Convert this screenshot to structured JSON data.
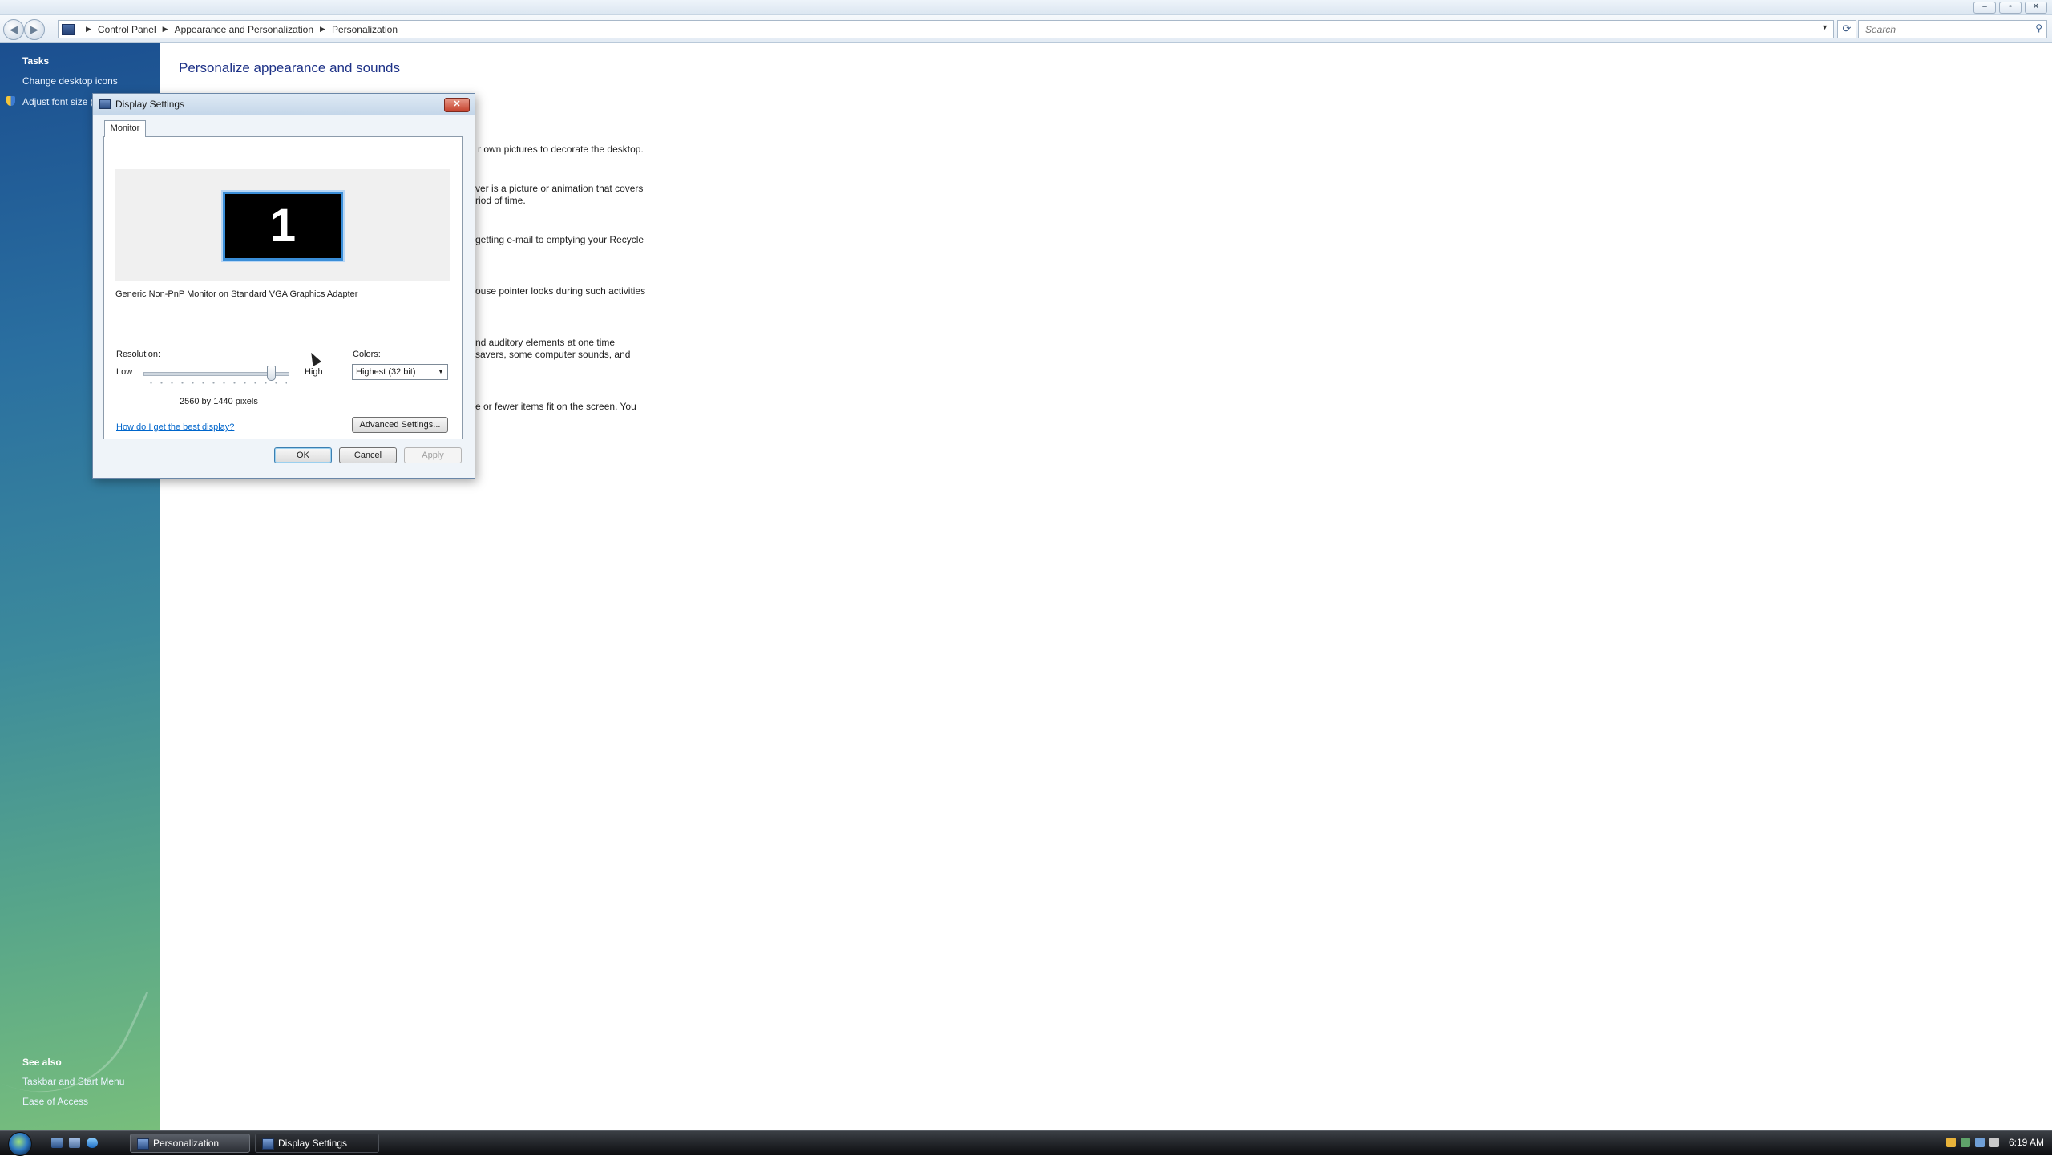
{
  "explorer": {
    "breadcrumb": [
      "Control Panel",
      "Appearance and Personalization",
      "Personalization"
    ],
    "search_placeholder": "Search",
    "window_controls": [
      "–",
      "▫",
      "✕"
    ]
  },
  "sidebar": {
    "tasks_heading": "Tasks",
    "tasks": [
      "Change desktop icons",
      "Adjust font size ("
    ],
    "see_also_heading": "See also",
    "see_also": [
      "Taskbar and Start Menu",
      "Ease of Access"
    ]
  },
  "main": {
    "title": "Personalize appearance and sounds",
    "fragments": [
      "r own pictures to decorate the desktop.",
      "ver is a picture or animation that covers",
      "riod of time.",
      "getting e-mail to emptying your Recycle",
      "ouse pointer looks during such activities",
      "nd auditory elements at one time",
      " savers, some computer sounds, and",
      "e or fewer items fit on the screen. You"
    ]
  },
  "dialog": {
    "title": "Display Settings",
    "tab": "Monitor",
    "monitor_number": "1",
    "monitor_description": "Generic Non-PnP Monitor on Standard VGA Graphics Adapter",
    "resolution_label": "Resolution:",
    "low": "Low",
    "high": "High",
    "resolution_value": "2560 by 1440 pixels",
    "resolution_slider_fraction": 1.0,
    "colors_label": "Colors:",
    "colors_value": "Highest (32 bit)",
    "help_link": "How do I get the best display?",
    "advanced_button": "Advanced Settings...",
    "ok": "OK",
    "cancel": "Cancel",
    "apply": "Apply"
  },
  "taskbar": {
    "items": [
      "Personalization",
      "Display Settings"
    ],
    "clock": "6:19 AM"
  },
  "colors": {
    "accent": "#1e3287",
    "link": "#0066cc",
    "monitor_highlight": "#3a8ed8"
  }
}
